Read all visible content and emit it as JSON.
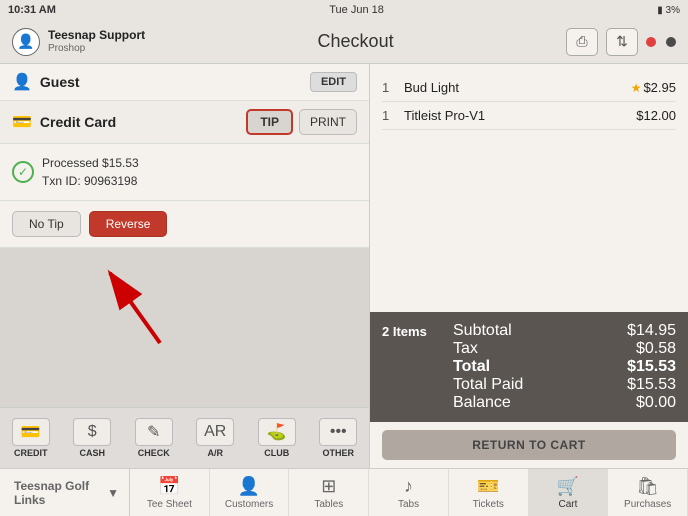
{
  "statusBar": {
    "time": "10:31 AM",
    "date": "Tue Jun 18",
    "battery": "3%"
  },
  "topBar": {
    "userName": "Teesnap Support",
    "userSub": "Proshop",
    "pageTitle": "Checkout"
  },
  "leftPanel": {
    "guestLabel": "Guest",
    "editLabel": "EDIT",
    "creditCardLabel": "Credit Card",
    "tipLabel": "TIP",
    "printLabel": "PRINT",
    "processedText": "Processed $15.53",
    "txnText": "Txn ID: 90963198",
    "noTipLabel": "No Tip",
    "reverseLabel": "Reverse"
  },
  "paymentMethods": [
    {
      "label": "CREDIT",
      "icon": "💳"
    },
    {
      "label": "CASH",
      "icon": "💵"
    },
    {
      "label": "CHECK",
      "icon": "🗒"
    },
    {
      "label": "A/R",
      "icon": "📋"
    },
    {
      "label": "CLUB",
      "icon": "🏌"
    },
    {
      "label": "OTHER",
      "icon": "⋯"
    }
  ],
  "orderItems": [
    {
      "qty": "1",
      "name": "Bud Light",
      "price": "$2.95",
      "starred": true
    },
    {
      "qty": "1",
      "name": "Titleist Pro-V1",
      "price": "$12.00",
      "starred": false
    }
  ],
  "summary": {
    "itemCount": "2 Items",
    "subtotalLabel": "Subtotal",
    "subtotalValue": "$14.95",
    "taxLabel": "Tax",
    "taxValue": "$0.58",
    "totalLabel": "Total",
    "totalValue": "$15.53",
    "totalPaidLabel": "Total Paid",
    "totalPaidValue": "$15.53",
    "balanceLabel": "Balance",
    "balanceValue": "$0.00"
  },
  "returnToCartLabel": "RETURN TO CART",
  "bottomNav": {
    "locationLabel": "Teesnap Golf Links",
    "items": [
      {
        "label": "Tee Sheet",
        "icon": "📅"
      },
      {
        "label": "Customers",
        "icon": "👤"
      },
      {
        "label": "Tables",
        "icon": "⊞"
      },
      {
        "label": "Tabs",
        "icon": "🎵"
      },
      {
        "label": "Tickets",
        "icon": "🎫"
      },
      {
        "label": "Cart",
        "icon": "🛒",
        "active": true
      },
      {
        "label": "Purchases",
        "icon": "🛍"
      }
    ]
  }
}
